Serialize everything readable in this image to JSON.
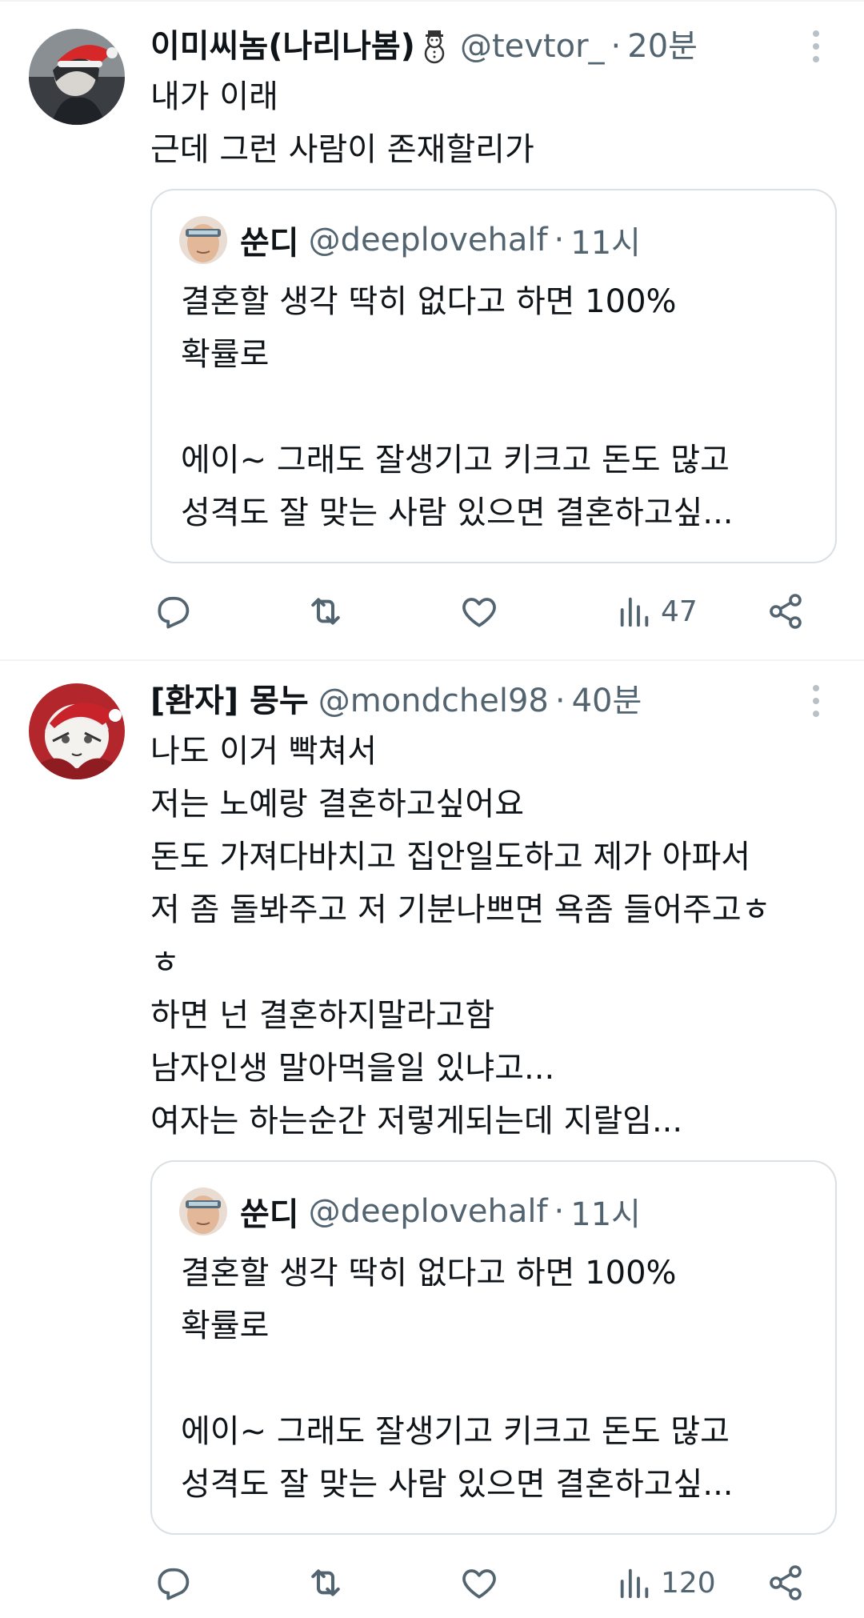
{
  "tweets": [
    {
      "author_name": "이미씨놈(나리나봄)",
      "author_emoji": "snowman-emoji",
      "handle": "@tevtor_",
      "separator": "·",
      "time": "20분",
      "text": "내가 이래\n근데 그런 사람이 존재할리가",
      "quote": {
        "author_name": "쑨디",
        "handle": "@deeplovehalf",
        "separator": "·",
        "time": "11시",
        "text": "결혼할 생각 딱히 없다고 하면 100%\n확률로\n\n에이~ 그래도 잘생기고 키크고 돈도 많고\n성격도 잘 맞는 사람 있으면 결혼하고싶..."
      },
      "actions": {
        "reply": "",
        "retweet": "",
        "like": "",
        "views": "47",
        "share": ""
      }
    },
    {
      "author_name": "[환자] 몽누",
      "handle": "@mondchel98",
      "separator": "·",
      "time": "40분",
      "text": "나도 이거 빡쳐서\n저는 노예랑 결혼하고싶어요\n돈도 가져다바치고 집안일도하고 제가 아파서\n저 좀 돌봐주고 저 기분나쁘면 욕좀 들어주고ㅎ\nㅎ\n하면 넌 결혼하지말라고함\n남자인생 말아먹을일 있냐고...\n여자는 하는순간 저렇게되는데 지랄임...",
      "quote": {
        "author_name": "쑨디",
        "handle": "@deeplovehalf",
        "separator": "·",
        "time": "11시",
        "text": "결혼할 생각 딱히 없다고 하면 100%\n확률로\n\n에이~ 그래도 잘생기고 키크고 돈도 많고\n성격도 잘 맞는 사람 있으면 결혼하고싶..."
      },
      "actions": {
        "reply": "",
        "retweet": "",
        "like": "",
        "views": "120",
        "share": ""
      }
    }
  ],
  "colors": {
    "text": "#0f1419",
    "secondary": "#536471",
    "border": "#d9dfe3",
    "divider": "#eff3f4"
  },
  "icons": [
    "reply-icon",
    "retweet-icon",
    "like-icon",
    "views-icon",
    "share-icon",
    "more-icon"
  ]
}
